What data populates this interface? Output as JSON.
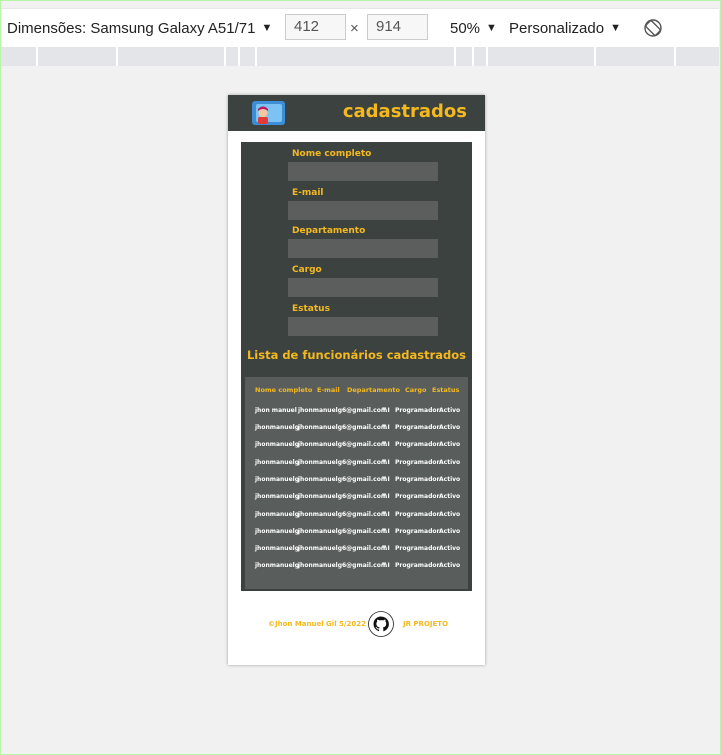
{
  "toolbar": {
    "dimensions_label": "Dimensões: Samsung Galaxy A51/71",
    "width_value": "412",
    "height_value": "914",
    "times": "×",
    "zoom": "50%",
    "throttle": "Personalizado",
    "arrow": "▼"
  },
  "header": {
    "title": "cadastrados"
  },
  "form": {
    "fields": [
      {
        "label": "Nome completo"
      },
      {
        "label": "E-mail"
      },
      {
        "label": "Departamento"
      },
      {
        "label": "Cargo"
      },
      {
        "label": "Estatus"
      }
    ]
  },
  "list": {
    "title": "Lista de funcionários cadastrados",
    "columns": [
      "Nome completo",
      "E-mail",
      "Departamento",
      "Cargo",
      "Estatus"
    ],
    "rows": [
      [
        "jhon manuel",
        "jhonmanuelg6@gmail.com",
        "T.I",
        "Programador",
        "Activo"
      ],
      [
        "jhonmanuelg",
        "jhonmanuelg6@gmail.com",
        "T.I",
        "Programador",
        "Activo"
      ],
      [
        "jhonmanuelg",
        "jhonmanuelg6@gmail.com",
        "T.I",
        "Programador",
        "Activo"
      ],
      [
        "jhonmanuelg",
        "jhonmanuelg6@gmail.com",
        "T.I",
        "Programador",
        "Activo"
      ],
      [
        "jhonmanuelg",
        "jhonmanuelg6@gmail.com",
        "T.I",
        "Programador",
        "Activo"
      ],
      [
        "jhonmanuelg",
        "jhonmanuelg6@gmail.com",
        "T.I",
        "Programador",
        "Activo"
      ],
      [
        "jhonmanuelg",
        "jhonmanuelg6@gmail.com",
        "T.I",
        "Programador",
        "Activo"
      ],
      [
        "jhonmanuelg",
        "jhonmanuelg6@gmail.com",
        "T.I",
        "Programador",
        "Activo"
      ],
      [
        "jhonmanuelg",
        "jhonmanuelg6@gmail.com",
        "T.I",
        "Programador",
        "Activo"
      ],
      [
        "jhonmanuelg",
        "jhonmanuelg6@gmail.com",
        "T.I",
        "Programador",
        "Activo"
      ]
    ]
  },
  "footer": {
    "copyright": "©Jhon Manuel Gil 5/2022",
    "project_link": "JR PROJETO"
  },
  "colors": {
    "accent": "#f5b91e",
    "panel": "#3b4240",
    "table": "#595e5d"
  }
}
